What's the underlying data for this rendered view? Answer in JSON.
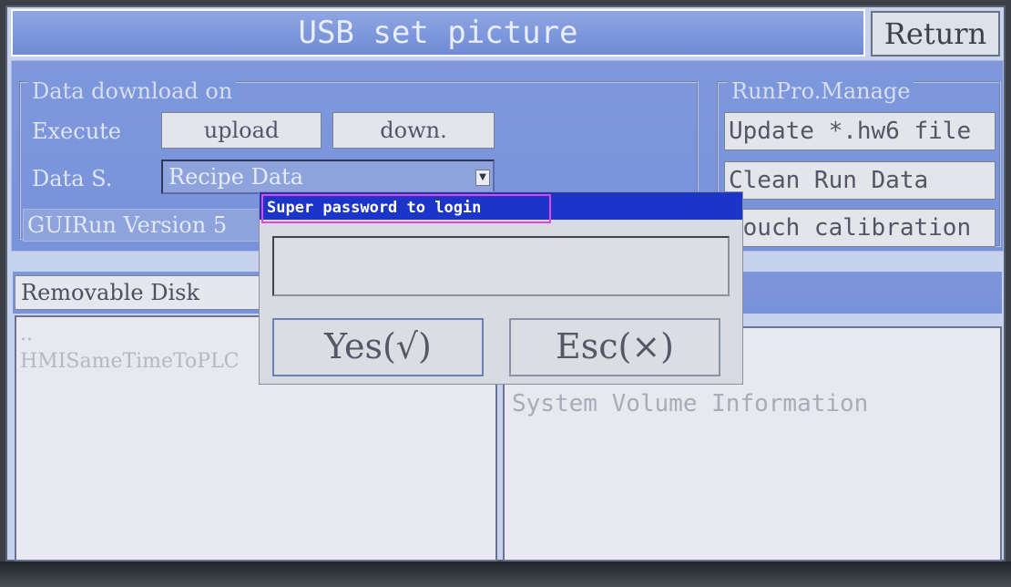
{
  "header": {
    "title": "USB set picture",
    "return_label": "Return"
  },
  "download_group": {
    "title": "Data download on",
    "execute_label": "Execute",
    "upload_label": "upload",
    "down_label": "down.",
    "data_source_label": "Data S.",
    "data_source_value": "Recipe Data",
    "version_text": "GUIRun Version 5"
  },
  "runpro_group": {
    "title": "RunPro.Manage",
    "update_label": "Update *.hw6 file",
    "clean_label": "Clean Run Data",
    "touch_label": "Touch calibration"
  },
  "disk": {
    "label": "Removable Disk"
  },
  "left_files": [
    "..",
    "HMISameTimeToPLC"
  ],
  "right_files": [
    "System Volume Information"
  ],
  "dialog": {
    "title": "Super password to login",
    "password_value": "",
    "yes_label": "Yes(√)",
    "esc_label": "Esc(×)"
  },
  "colors": {
    "panel_blue": "#7f98dc",
    "dialog_title_blue": "#1b35c9",
    "highlight_magenta": "#e845e6"
  }
}
